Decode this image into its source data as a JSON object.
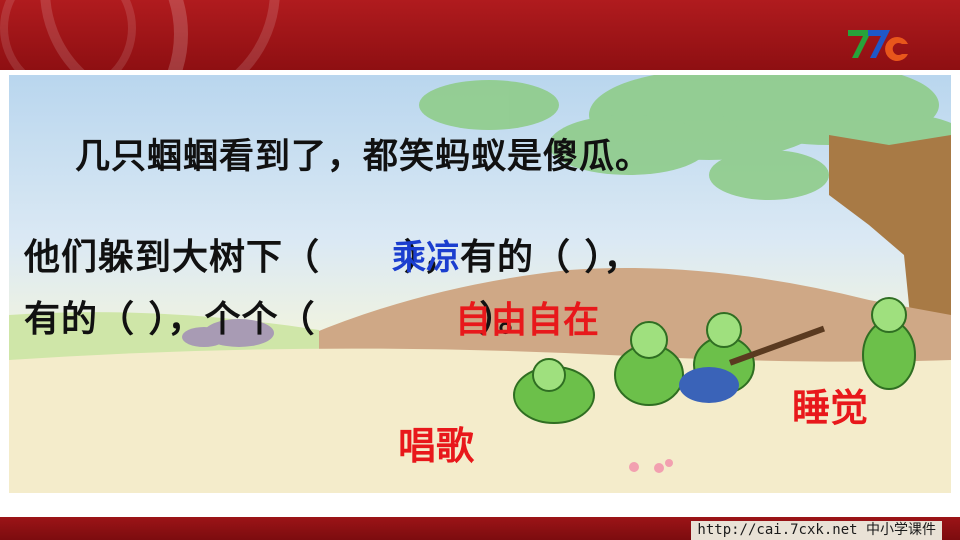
{
  "slide": {
    "line1": "几只蝈蝈看到了，都笑蚂蚁是傻瓜。",
    "line2_part1": "他们躲到大树下（",
    "line2_fill": "乘凉",
    "line2_part2": "），有的（      ），",
    "line3_part1": "有的（      ），个个（",
    "line3_fill": "自由自在",
    "line3_part2": "）。",
    "answer_sing": "唱歌",
    "answer_sleep": "睡觉"
  },
  "footer": {
    "url": "http://cai.7cxk.net",
    "label": "中小学课件"
  },
  "colors": {
    "header_red": "#9c1417",
    "fill_blue": "#1b3ecf",
    "fill_red": "#e8181b"
  }
}
